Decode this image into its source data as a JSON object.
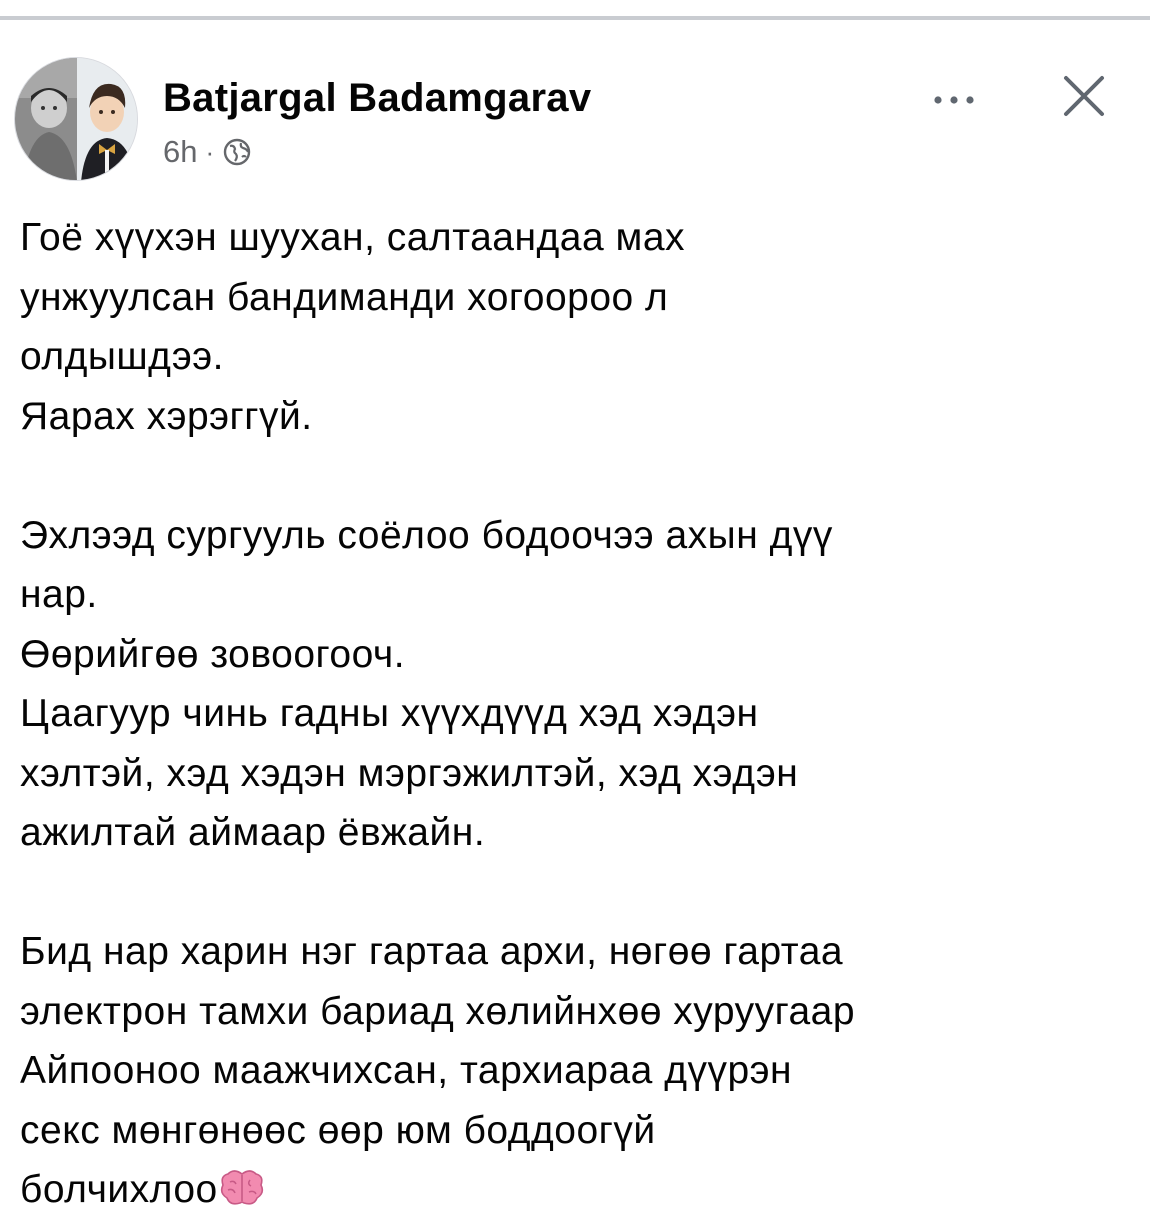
{
  "post": {
    "author": "Batjargal Badamgarav",
    "timestamp": "6h",
    "separator": "·",
    "audience_icon": "globe-icon",
    "more_icon": "more-horizontal-icon",
    "close_icon": "close-icon",
    "paragraphs": [
      [
        "Гоё хүүхэн шуухан, салтаандаа мах",
        "унжуулсан бандиманди хогоороо л",
        "олдышдээ.",
        "Яарах хэрэггүй."
      ],
      [
        "Эхлээд сургууль соёлоо бодоочээ ахын дүү",
        "нар.",
        "Өөрийгөө зовоогооч.",
        "Цаагуур чинь гадны хүүхдүүд хэд хэдэн",
        "хэлтэй, хэд хэдэн мэргэжилтэй, хэд хэдэн",
        "ажилтай аймаар ёвжайн."
      ],
      [
        "Бид нар харин нэг гартаа архи, нөгөө гартаа",
        "электрон тамхи бариад хөлийнхөө хуруугаар",
        "Айпооноо маажчихсан, тархиараа дүүрэн",
        "секс мөнгөнөөс өөр юм боддоогүй",
        "болчихлоо"
      ]
    ],
    "trailing_emoji": "brain-icon"
  },
  "colors": {
    "text": "#050505",
    "meta": "#65676b",
    "icon": "#606770",
    "divider": "#c9ccd1",
    "emoji": "#f28bb0"
  }
}
